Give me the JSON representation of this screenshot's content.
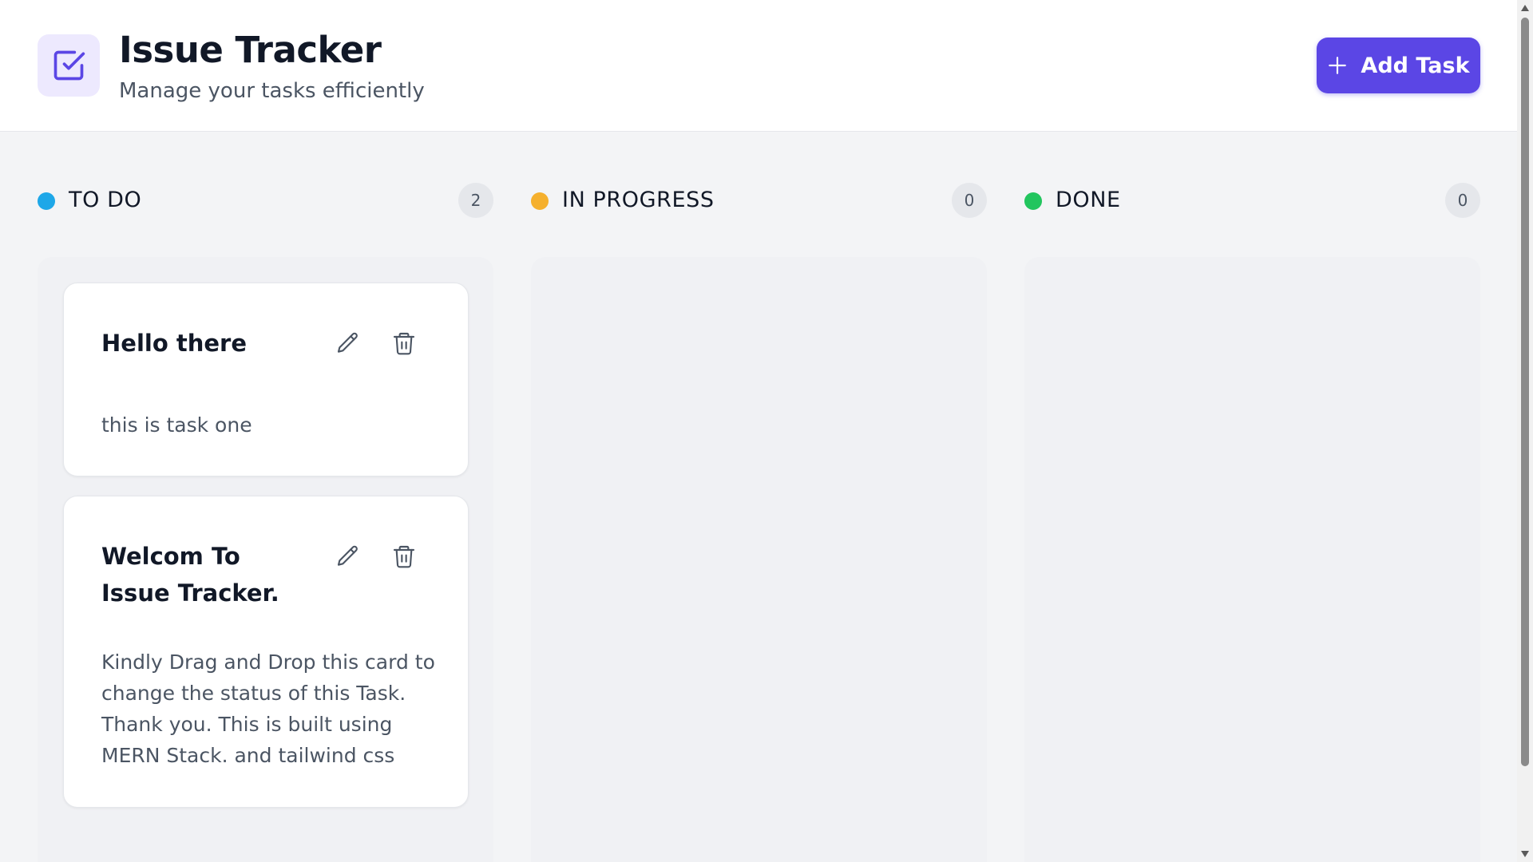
{
  "header": {
    "title": "Issue Tracker",
    "subtitle": "Manage your tasks efficiently",
    "logo_icon": "checkbox-icon",
    "add_button": {
      "label": "Add Task",
      "icon": "plus-icon"
    }
  },
  "colors": {
    "accent": "#5b46e5",
    "todo": "#1ea7e8",
    "in_progress": "#f5b02e",
    "done": "#22c55e"
  },
  "columns": [
    {
      "title": "TO DO",
      "count": "2",
      "cards": [
        {
          "title": "Hello there",
          "description": "this is task one"
        },
        {
          "title": "Welcom To Issue Tracker.",
          "description": "Kindly Drag and Drop this card to change the status of this Task. Thank you. This is built using MERN Stack. and tailwind css"
        }
      ]
    },
    {
      "title": "IN PROGRESS",
      "count": "0",
      "cards": []
    },
    {
      "title": "DONE",
      "count": "0",
      "cards": []
    }
  ]
}
